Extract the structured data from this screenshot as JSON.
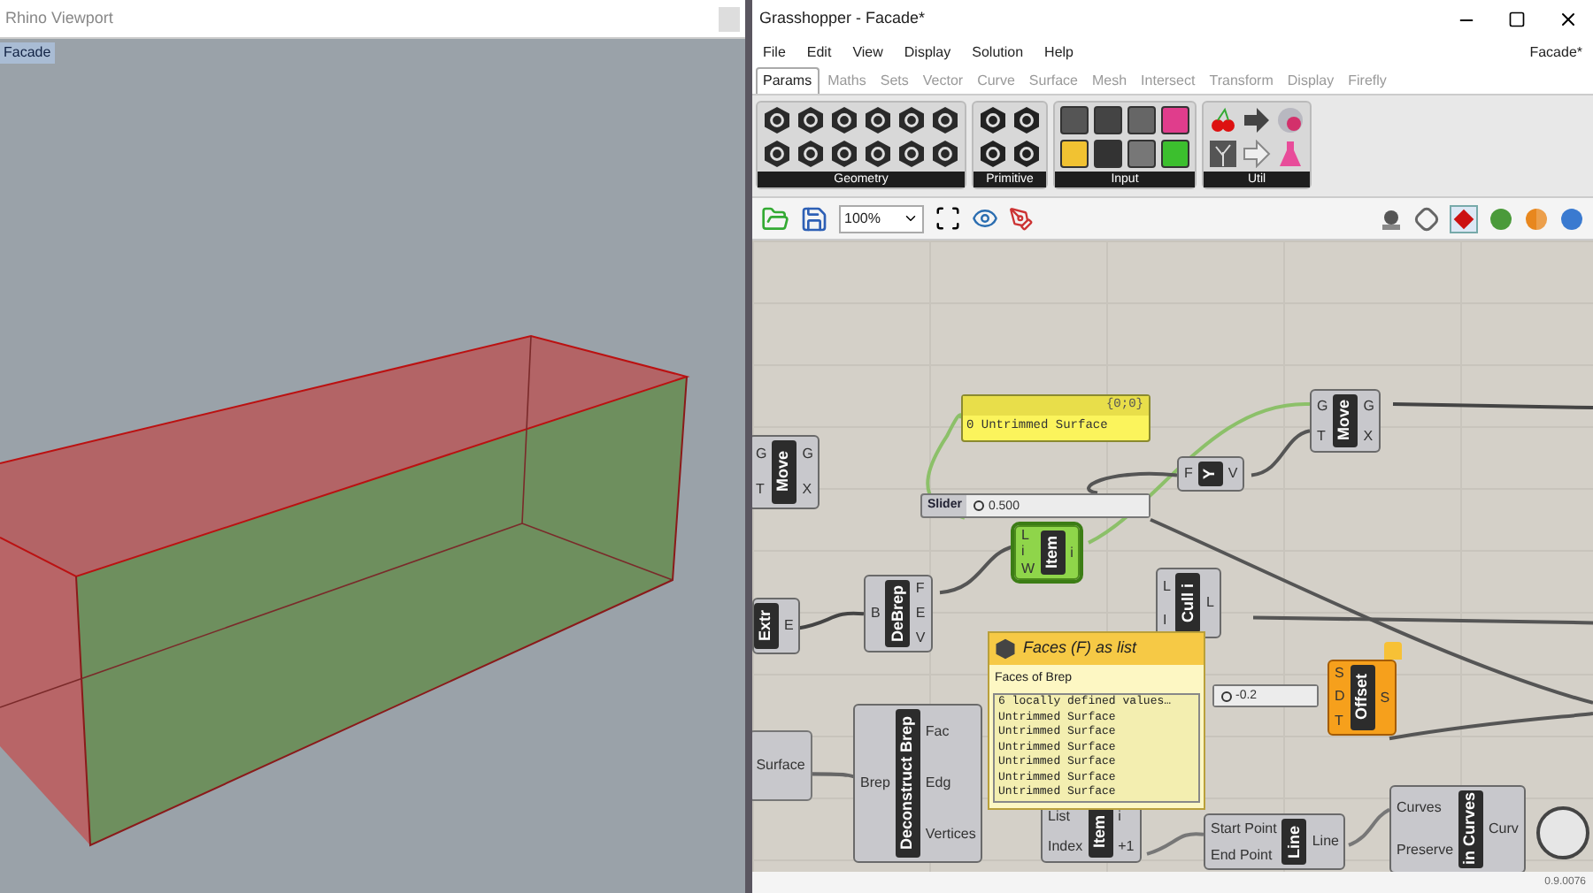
{
  "rhino": {
    "title": "Rhino Viewport",
    "viewport_label": "Facade"
  },
  "grasshopper": {
    "title": "Grasshopper - Facade*",
    "menu": [
      "File",
      "Edit",
      "View",
      "Display",
      "Solution",
      "Help"
    ],
    "document": "Facade*",
    "tabs": [
      {
        "label": "Params",
        "selected": true
      },
      {
        "label": "Maths",
        "selected": false
      },
      {
        "label": "Sets",
        "selected": false
      },
      {
        "label": "Vector",
        "selected": false
      },
      {
        "label": "Curve",
        "selected": false
      },
      {
        "label": "Surface",
        "selected": false
      },
      {
        "label": "Mesh",
        "selected": false
      },
      {
        "label": "Intersect",
        "selected": false
      },
      {
        "label": "Transform",
        "selected": false
      },
      {
        "label": "Display",
        "selected": false
      },
      {
        "label": "Firefly",
        "selected": false
      }
    ],
    "ribbon_groups": [
      "Geometry",
      "Primitive",
      "Input",
      "Util"
    ],
    "zoom": "100%"
  },
  "canvas": {
    "nodes": [
      {
        "kind": "component",
        "name": "Move",
        "inputs": [
          "G",
          "T"
        ],
        "outputs": [
          "G",
          "X"
        ],
        "selected": false,
        "warning": false
      },
      {
        "kind": "panel",
        "header": "{0;0}",
        "lines": [
          "0 Untrimmed Surface"
        ]
      },
      {
        "kind": "component",
        "name": "Move",
        "inputs": [
          "G",
          "T"
        ],
        "outputs": [
          "G",
          "X"
        ],
        "selected": false,
        "warning": false
      },
      {
        "kind": "component",
        "name": "Y",
        "inputs": [
          "F"
        ],
        "outputs": [
          "V"
        ],
        "selected": false,
        "warning": false
      },
      {
        "kind": "slider",
        "name": "Slider",
        "value": "0.500"
      },
      {
        "kind": "component",
        "name": "Item",
        "inputs": [
          "L",
          "i",
          "W"
        ],
        "outputs": [
          "i"
        ],
        "selected": true,
        "warning": false
      },
      {
        "kind": "component",
        "name": "Extr",
        "outputs": [
          "E"
        ],
        "selected": false,
        "warning": false
      },
      {
        "kind": "component",
        "name": "DeBrep",
        "inputs": [
          "B"
        ],
        "outputs": [
          "F",
          "E",
          "V"
        ],
        "selected": false,
        "warning": false
      },
      {
        "kind": "component",
        "name": "Cull i",
        "inputs": [
          "L",
          "I"
        ],
        "outputs": [
          "L"
        ],
        "selected": false,
        "warning": false
      },
      {
        "kind": "slider",
        "value": "-0.2"
      },
      {
        "kind": "component",
        "name": "Offset",
        "inputs": [
          "S",
          "D",
          "T"
        ],
        "outputs": [
          "S"
        ],
        "selected": false,
        "warning": true
      },
      {
        "kind": "param",
        "name": "Surface"
      },
      {
        "kind": "component",
        "name": "Deconstruct Brep",
        "inputs": [
          "Brep"
        ],
        "outputs": [
          "Fac",
          "Edg",
          "Vertices"
        ],
        "selected": false,
        "warning": false
      },
      {
        "kind": "component",
        "name": "Item",
        "inputs": [
          "List",
          "Index"
        ],
        "outputs": [
          "i",
          "+1"
        ],
        "selected": false,
        "warning": false
      },
      {
        "kind": "component",
        "name": "Line",
        "inputs": [
          "Start Point",
          "End Point"
        ],
        "outputs": [
          "Line"
        ],
        "selected": false,
        "warning": false
      },
      {
        "kind": "component",
        "name": "in Curves",
        "inputs": [
          "Curves",
          "Preserve"
        ],
        "outputs": [
          "Curv"
        ],
        "selected": false,
        "warning": false
      }
    ],
    "tooltip": {
      "title": "Faces (F) as list",
      "description": "Faces of Brep",
      "values": [
        "6 locally defined values…",
        "Untrimmed Surface",
        "Untrimmed Surface",
        "Untrimmed Surface",
        "Untrimmed Surface",
        "Untrimmed Surface",
        "Untrimmed Surface"
      ]
    }
  },
  "status": "0.9.0076"
}
